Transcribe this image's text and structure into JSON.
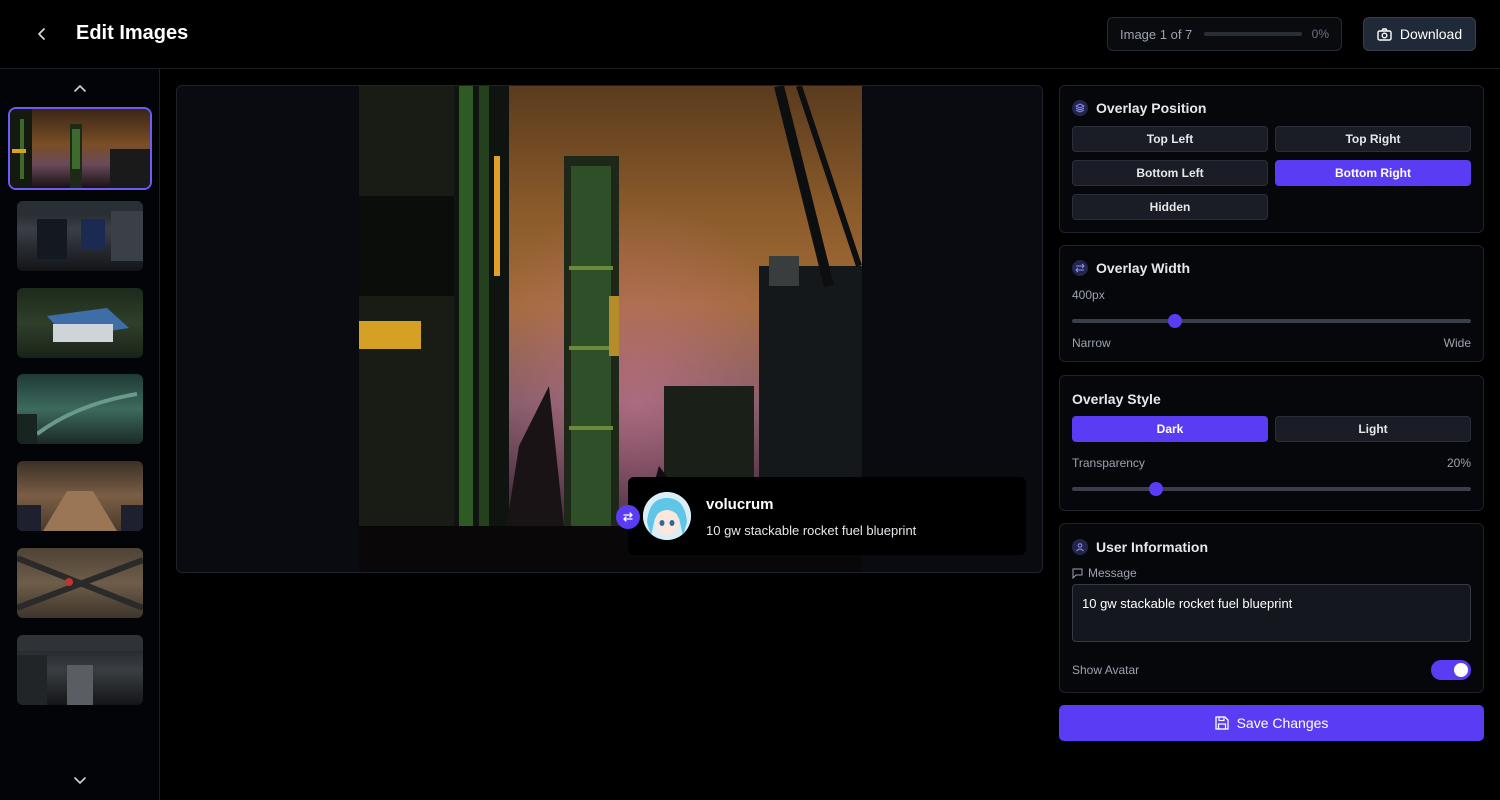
{
  "header": {
    "title": "Edit Images",
    "counter": "Image 1 of 7",
    "progress_percent": "0%",
    "progress_fraction": 0,
    "download_label": "Download"
  },
  "sidebar": {
    "thumbnails": [
      {
        "name": "industrial towers at dusk",
        "active": true
      },
      {
        "name": "dark factory interior"
      },
      {
        "name": "blue roof building"
      },
      {
        "name": "green foggy landscape"
      },
      {
        "name": "desert roads"
      },
      {
        "name": "road intersection aerial"
      },
      {
        "name": "dark machinery interior"
      }
    ]
  },
  "overlay": {
    "username": "volucrum",
    "message": "10 gw stackable rocket fuel blueprint"
  },
  "position_panel": {
    "title": "Overlay Position",
    "options": [
      "Top Left",
      "Top Right",
      "Bottom Left",
      "Bottom Right",
      "Hidden"
    ],
    "selected": "Bottom Right"
  },
  "width_panel": {
    "title": "Overlay Width",
    "value": "400px",
    "min_label": "Narrow",
    "max_label": "Wide"
  },
  "style_panel": {
    "title": "Overlay Style",
    "options": [
      "Dark",
      "Light"
    ],
    "selected": "Dark",
    "transparency_label": "Transparency",
    "transparency_value": "20%"
  },
  "user_panel": {
    "title": "User Information",
    "message_label": "Message",
    "message_value": "10 gw stackable rocket fuel blueprint",
    "avatar_label": "Show Avatar",
    "avatar_on": true
  },
  "save_label": "Save Changes",
  "colors": {
    "accent": "#5b3cf5",
    "background": "#000000",
    "panel": "#06070b"
  }
}
